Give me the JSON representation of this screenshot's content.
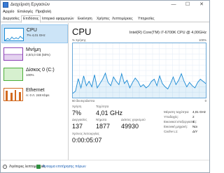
{
  "window": {
    "title": "Διαχείριση Εργασιών"
  },
  "titlebar_buttons": {
    "minimize": "—",
    "maximize": "☐",
    "close": "✕"
  },
  "menu": [
    "Αρχείο",
    "Επιλογές",
    "Προβολή"
  ],
  "tabs": [
    "Διεργασίες",
    "Επιδόσεις",
    "Ιστορικό εφαρμογών",
    "Εκκίνηση",
    "Χρήστες",
    "Λεπτομέρειες",
    "Υπηρεσίες"
  ],
  "active_tab": "Επιδόσεις",
  "sidebar": [
    {
      "title": "CPU",
      "sub": "7% 4,01 GHz",
      "color": "#1a8ad4"
    },
    {
      "title": "Μνήμη",
      "sub": "2,0/4,0 GB (50%)",
      "color": "#8b3fb5"
    },
    {
      "title": "Δίσκος 0 (C:)",
      "sub": "100%",
      "color": "#4caf38"
    },
    {
      "title": "Ethernet",
      "sub": "Α: 0 Λ: 248 Kbps",
      "color": "#d2691e"
    }
  ],
  "main": {
    "title": "CPU",
    "model": "Intel(R) Core(TM) i7-6700K CPU @ 4,00GHz",
    "graph_top_left": "% Χρήσης",
    "graph_top_right": "100%",
    "graph_bottom_left": "60 δευτερόλεπτα",
    "graph_bottom_right": "0",
    "stats": {
      "usage_label": "Χρήση",
      "usage_value": "7%",
      "speed_label": "Ταχύτητα",
      "speed_value": "4,01 GHz",
      "processes_label": "Διεργασίες",
      "processes_value": "137",
      "threads_label": "Νήματα",
      "threads_value": "1877",
      "handles_label": "Δείκτες χειρισμού",
      "handles_value": "49930",
      "uptime_label": "Χρόνος λειτουργίας",
      "uptime_value": "0:00:05:07"
    },
    "specs": [
      {
        "label": "Μέγιστη ταχύτητα:",
        "value": "4,01 GHz"
      },
      {
        "label": "Υποδοχές:",
        "value": "2"
      },
      {
        "label": "Εικονικοί επεξεργαστές:",
        "value": "4"
      },
      {
        "label": "Εικονική μηχανή:",
        "value": "Ναι"
      },
      {
        "label": "Cache L1:",
        "value": "Δ/Υ"
      }
    ]
  },
  "footer": {
    "fewer_details": "Λιγότερες λεπτομέρειες",
    "open_monitor": "Άνοιγμα επιτήρησης πόρων"
  },
  "cpu_usage_history": [
    8,
    12,
    35,
    18,
    40,
    22,
    30,
    20,
    42,
    18,
    26,
    34,
    45,
    28,
    22,
    38,
    30,
    24,
    44,
    26,
    32,
    18,
    28,
    36,
    30,
    20,
    24,
    18,
    22,
    30,
    34,
    22,
    40,
    26,
    20,
    16,
    26,
    38,
    24,
    32,
    44,
    30,
    20,
    28,
    22,
    18,
    28,
    34,
    30,
    26
  ]
}
